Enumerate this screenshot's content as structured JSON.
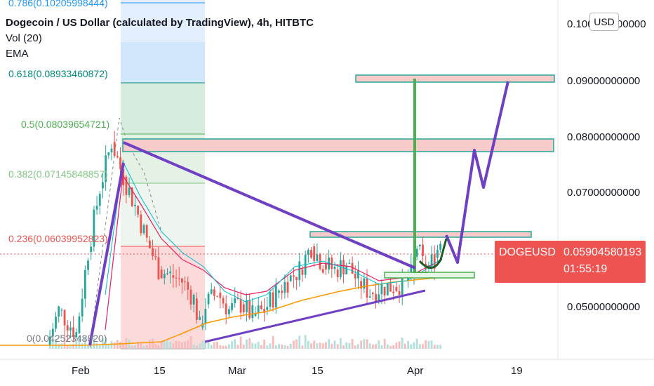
{
  "header": {
    "title": "Dogecoin / US Dollar (calculated by TradingView), 4h, HITBTC",
    "indicator_vol": "Vol (20)",
    "indicator_ema": "EMA",
    "currency_button": "USD"
  },
  "price_label": {
    "symbol": "DOGEUSD",
    "price": "0.05904580193",
    "countdown": "01:55:19"
  },
  "colors": {
    "candle_up": "#26a69a",
    "candle_down": "#ef5350",
    "trend_purple": "#6f3fc4",
    "fib_blue": "#2196f3",
    "fib_green": "#4caf50",
    "fib_red": "#ef5350",
    "ema_orange": "#ff9800",
    "ema_pink": "#e91e63",
    "ema_cyan": "#00bcd4"
  },
  "chart_data": {
    "type": "candlestick",
    "symbol": "DOGEUSD",
    "interval": "4h",
    "exchange": "HITBTC",
    "y_tick_labels": [
      "0.100000000000",
      "0.09000000000",
      "0.08000000000",
      "0.07000000000",
      "0.05000000000"
    ],
    "y_ticks": [
      0.1,
      0.09,
      0.08,
      0.07,
      0.05
    ],
    "x_tick_labels": [
      "Feb",
      "15",
      "Mar",
      "15",
      "Apr",
      "19"
    ],
    "x_ticks": [
      "2021-02-01",
      "2021-02-15",
      "2021-03-01",
      "2021-03-15",
      "2021-04-01",
      "2021-04-19"
    ],
    "ylim": [
      0.0415,
      0.1035
    ],
    "xlim": [
      "2021-01-20",
      "2021-04-25"
    ],
    "fibonacci_levels": [
      {
        "ratio": "0.786",
        "label": "0.786(0.10205998444)",
        "value": 0.10205998444
      },
      {
        "ratio": "0.618",
        "label": "0.618(0.08933460872)",
        "value": 0.08933460872
      },
      {
        "ratio": "0.5",
        "label": "0.5(0.08039654721)",
        "value": 0.08039654721
      },
      {
        "ratio": "0.382",
        "label": "0.382(0.07145848857)",
        "value": 0.07145848857
      },
      {
        "ratio": "0.236",
        "label": "0.236(0.06039952823)",
        "value": 0.06039952823
      },
      {
        "ratio": "0",
        "label": "0(0.04252348820)",
        "value": 0.0425234882
      }
    ],
    "close_price_approx": [
      [
        "2021-01-28",
        0.044
      ],
      [
        "2021-01-30",
        0.05
      ],
      [
        "2021-02-02",
        0.046
      ],
      [
        "2021-02-04",
        0.06
      ],
      [
        "2021-02-06",
        0.071
      ],
      [
        "2021-02-08",
        0.079
      ],
      [
        "2021-02-10",
        0.073
      ],
      [
        "2021-02-12",
        0.068
      ],
      [
        "2021-02-14",
        0.062
      ],
      [
        "2021-02-16",
        0.057
      ],
      [
        "2021-02-18",
        0.056
      ],
      [
        "2021-02-20",
        0.055
      ],
      [
        "2021-02-22",
        0.052
      ],
      [
        "2021-02-23",
        0.047
      ],
      [
        "2021-02-24",
        0.051
      ],
      [
        "2021-02-26",
        0.053
      ],
      [
        "2021-02-28",
        0.05
      ],
      [
        "2021-03-02",
        0.051
      ],
      [
        "2021-03-04",
        0.049
      ],
      [
        "2021-03-06",
        0.05
      ],
      [
        "2021-03-08",
        0.053
      ],
      [
        "2021-03-10",
        0.055
      ],
      [
        "2021-03-12",
        0.057
      ],
      [
        "2021-03-14",
        0.061
      ],
      [
        "2021-03-16",
        0.058
      ],
      [
        "2021-03-18",
        0.057
      ],
      [
        "2021-03-20",
        0.058
      ],
      [
        "2021-03-22",
        0.055
      ],
      [
        "2021-03-24",
        0.053
      ],
      [
        "2021-03-26",
        0.054
      ],
      [
        "2021-03-28",
        0.054
      ],
      [
        "2021-03-30",
        0.055
      ],
      [
        "2021-03-31",
        0.056
      ],
      [
        "2021-04-01",
        0.061
      ],
      [
        "2021-04-02",
        0.058
      ],
      [
        "2021-04-03",
        0.0575
      ],
      [
        "2021-04-04",
        0.059
      ],
      [
        "2021-04-05",
        0.062
      ]
    ],
    "drawn_projection": [
      [
        "2021-04-05",
        0.0615
      ],
      [
        "2021-04-07",
        0.0578
      ],
      [
        "2021-04-11",
        0.0775
      ],
      [
        "2021-04-13",
        0.0705
      ],
      [
        "2021-04-17",
        0.0895
      ]
    ],
    "support_zones": [
      0.0892,
      0.0778,
      0.0625,
      0.0562
    ]
  }
}
